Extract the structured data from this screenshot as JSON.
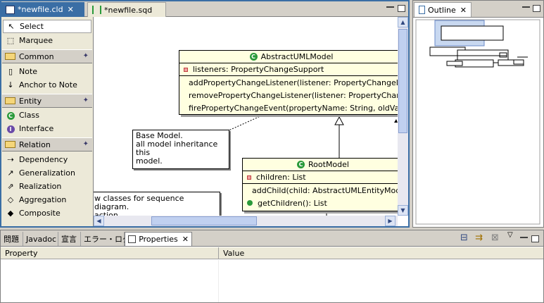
{
  "editor": {
    "tabs": [
      {
        "label": "*newfile.cld",
        "close": "✕"
      },
      {
        "label": "*newfile.sqd"
      }
    ]
  },
  "palette": {
    "tools": [
      {
        "label": "Select",
        "icon": "arrow-cursor-icon"
      },
      {
        "label": "Marquee",
        "icon": "marquee-icon"
      }
    ],
    "drawers": [
      {
        "label": "Common",
        "items": [
          {
            "label": "Note",
            "icon": "note-icon"
          },
          {
            "label": "Anchor to Note",
            "icon": "anchor-icon"
          }
        ]
      },
      {
        "label": "Entity",
        "items": [
          {
            "label": "Class",
            "icon": "class-icon"
          },
          {
            "label": "Interface",
            "icon": "interface-icon"
          }
        ]
      },
      {
        "label": "Relation",
        "items": [
          {
            "label": "Dependency",
            "icon": "dependency-icon"
          },
          {
            "label": "Generalization",
            "icon": "generalization-icon"
          },
          {
            "label": "Realization",
            "icon": "realization-icon"
          },
          {
            "label": "Aggregation",
            "icon": "aggregation-icon"
          },
          {
            "label": "Composite",
            "icon": "composite-icon"
          }
        ]
      }
    ]
  },
  "diagram": {
    "class1": {
      "name": "AbstractUMLModel",
      "field": "listeners: PropertyChangeSupport",
      "methods": [
        "addPropertyChangeListener(listener: PropertyChangeListe",
        "removePropertyChangeListener(listener: PropertyChangeL",
        "firePropertyChangeEvent(propertyName: String, oldValue:"
      ]
    },
    "class2": {
      "name": "RootModel",
      "field": "children: List",
      "methods": [
        "addChild(child: AbstractUMLEntityMode",
        "getChildren(): List"
      ]
    },
    "note1": [
      "Base Model.",
      "all model inheritance this",
      "model."
    ],
    "note2": [
      "w classes for sequence diagram.",
      "action"
    ]
  },
  "outline": {
    "tab_label": "Outline",
    "close": "✕"
  },
  "bottom": {
    "tabs": [
      "問題",
      "Javadoc",
      "宣言",
      "エラー・ログ",
      "Properties"
    ],
    "properties_close": "✕",
    "columns": [
      "Property",
      "Value"
    ]
  },
  "colors": {
    "accent": "#3a6ea5",
    "class_fill": "#ffffe0",
    "icon_green": "#2a9a3a"
  }
}
